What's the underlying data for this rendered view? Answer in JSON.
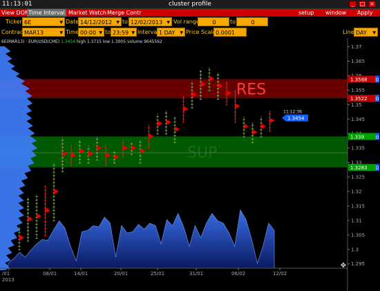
{
  "titlebar": {
    "time": "11:13:01",
    "title": "cluster profile",
    "minimize": "_",
    "maximize": "□",
    "close": "×"
  },
  "menu": {
    "items": [
      "View DOM",
      "Time Interval",
      "Market Watch",
      "Merge Contr"
    ],
    "active_item": "Time Interval",
    "right_items": [
      "setup",
      "window",
      "Apply"
    ]
  },
  "form": {
    "ticker_label": "Ticker",
    "ticker": "6E",
    "date_label": "Date",
    "date_from": "14/12/2012",
    "date_to_label": "to",
    "date_to": "12/02/2013",
    "volrange_label": "Vol range",
    "vol_from": "0",
    "vol_to_label": "to",
    "vol_to": "0",
    "contract_label": "Contract",
    "contract": "MAR13",
    "time_label": "Time",
    "time_from": "00:00",
    "time_to_label": "to",
    "time_to": "23:59",
    "interval_label": "Interval",
    "interval": "1 DAY",
    "pricescale_label": "Price Scale",
    "pricescale": "0.0001",
    "line_label": "Line",
    "line": "DAY"
  },
  "infoline": {
    "symbol": "6E(MAR13) · EUR/USD(CME)",
    "last": "1.3454",
    "high": "high 1.3715",
    "low": "low 1.3005",
    "volume": "volume 9645562"
  },
  "chart": {
    "zones": [
      {
        "label": "RES",
        "high": 1.3588,
        "low": 1.3522,
        "color": "#c00000"
      },
      {
        "label": "SUP",
        "high": 1.339,
        "low": 1.3283,
        "color": "#00a000"
      }
    ],
    "price_ticks": [
      "1.37",
      "1.365",
      "1.36",
      "1.355",
      "1.35",
      "1.345",
      "1.34",
      "1.335",
      "1.33",
      "1.325",
      "1.32",
      "1.315",
      "1.31",
      "1.305",
      "1.3",
      "1.295"
    ],
    "price_tags": [
      {
        "value": "1.3588",
        "color": "#c00000"
      },
      {
        "value": "1.3522",
        "color": "#c00000"
      },
      {
        "value": "1.339",
        "color": "#00a000"
      },
      {
        "value": "1.3283",
        "color": "#00a000"
      }
    ],
    "last_price": {
      "time": "11:12:36",
      "value": "1.3454",
      "color": "#1060ff"
    },
    "date_ticks": [
      "/01",
      "08/01",
      "14/01",
      "20/01",
      "25/01",
      "31/01",
      "06/02",
      "12/02"
    ],
    "year_label": "2013",
    "volume_series": [
      0.08,
      0.16,
      0.26,
      0.18,
      0.3,
      0.4,
      0.47,
      0.46,
      0.63,
      0.78,
      0.66,
      0.36,
      0.12,
      0.6,
      0.62,
      0.7,
      0.68,
      0.84,
      0.74,
      0.18,
      0.7,
      0.58,
      0.6,
      0.72,
      0.64,
      0.74,
      0.7,
      0.4,
      0.8,
      0.7,
      0.9,
      0.68,
      0.36,
      0.7,
      0.5,
      0.74,
      0.9,
      0.78,
      0.74,
      0.58,
      0.36,
      0.96,
      0.8,
      0.48,
      0.08,
      0.36,
      0.74,
      0.62
    ],
    "volume_color": "#3a6ee8",
    "profile_color": "#3f7fff"
  }
}
